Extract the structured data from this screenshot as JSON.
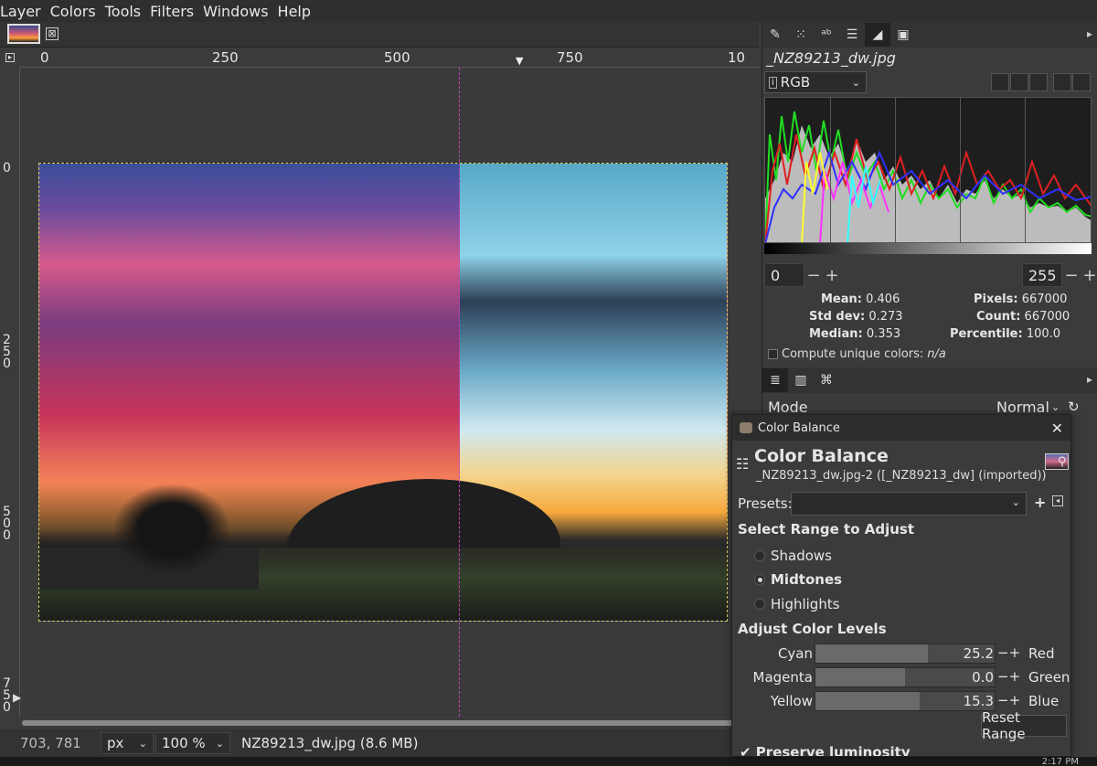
{
  "menubar": [
    "Layer",
    "Colors",
    "Tools",
    "Filters",
    "Windows",
    "Help"
  ],
  "tab": {
    "close_glyph": "⊠"
  },
  "hruler": {
    "labels": [
      "0",
      "250",
      "500",
      "750",
      "10"
    ]
  },
  "vruler": {
    "labels": [
      "0",
      "250",
      "500",
      "750"
    ]
  },
  "status": {
    "coords": "703, 781",
    "unit": "px",
    "zoom": "100 %",
    "file": "NZ89213_dw.jpg (8.6 MB)"
  },
  "taskbar": {
    "clock": "2:17 PM"
  },
  "histogram": {
    "title": "_NZ89213_dw.jpg",
    "channel": "RGB",
    "range_low": "0",
    "range_high": "255",
    "labels": {
      "mean": "Mean:",
      "std_dev": "Std dev:",
      "median": "Median:",
      "pixels": "Pixels:",
      "count": "Count:",
      "percentile": "Percentile:"
    },
    "values": {
      "mean": "0.406",
      "std_dev": "0.273",
      "median": "0.353",
      "pixels": "667000",
      "count": "667000",
      "percentile": "100.0"
    },
    "compute_label": "Compute unique colors:",
    "compute_value": "n/a"
  },
  "layers": {
    "mode_label": "Mode",
    "mode_value": "Normal"
  },
  "color_balance": {
    "window_title": "Color Balance",
    "heading": "Color Balance",
    "subtitle": "_NZ89213_dw.jpg-2 ([_NZ89213_dw] (imported))",
    "presets_label": "Presets:",
    "select_range_label": "Select Range to Adjust",
    "ranges": [
      "Shadows",
      "Midtones",
      "Highlights"
    ],
    "selected_range": "Midtones",
    "adjust_label": "Adjust Color Levels",
    "levels": [
      {
        "left": "Cyan",
        "value": "25.2",
        "right": "Red",
        "fill": 0.63
      },
      {
        "left": "Magenta",
        "value": "0.0",
        "right": "Green",
        "fill": 0.5
      },
      {
        "left": "Yellow",
        "value": "15.3",
        "right": "Blue",
        "fill": 0.58
      }
    ],
    "reset_label": "Reset Range",
    "preserve_label": "Preserve luminosity"
  },
  "colors": {
    "guide": "#c040c0",
    "selection": "#d8d060"
  }
}
